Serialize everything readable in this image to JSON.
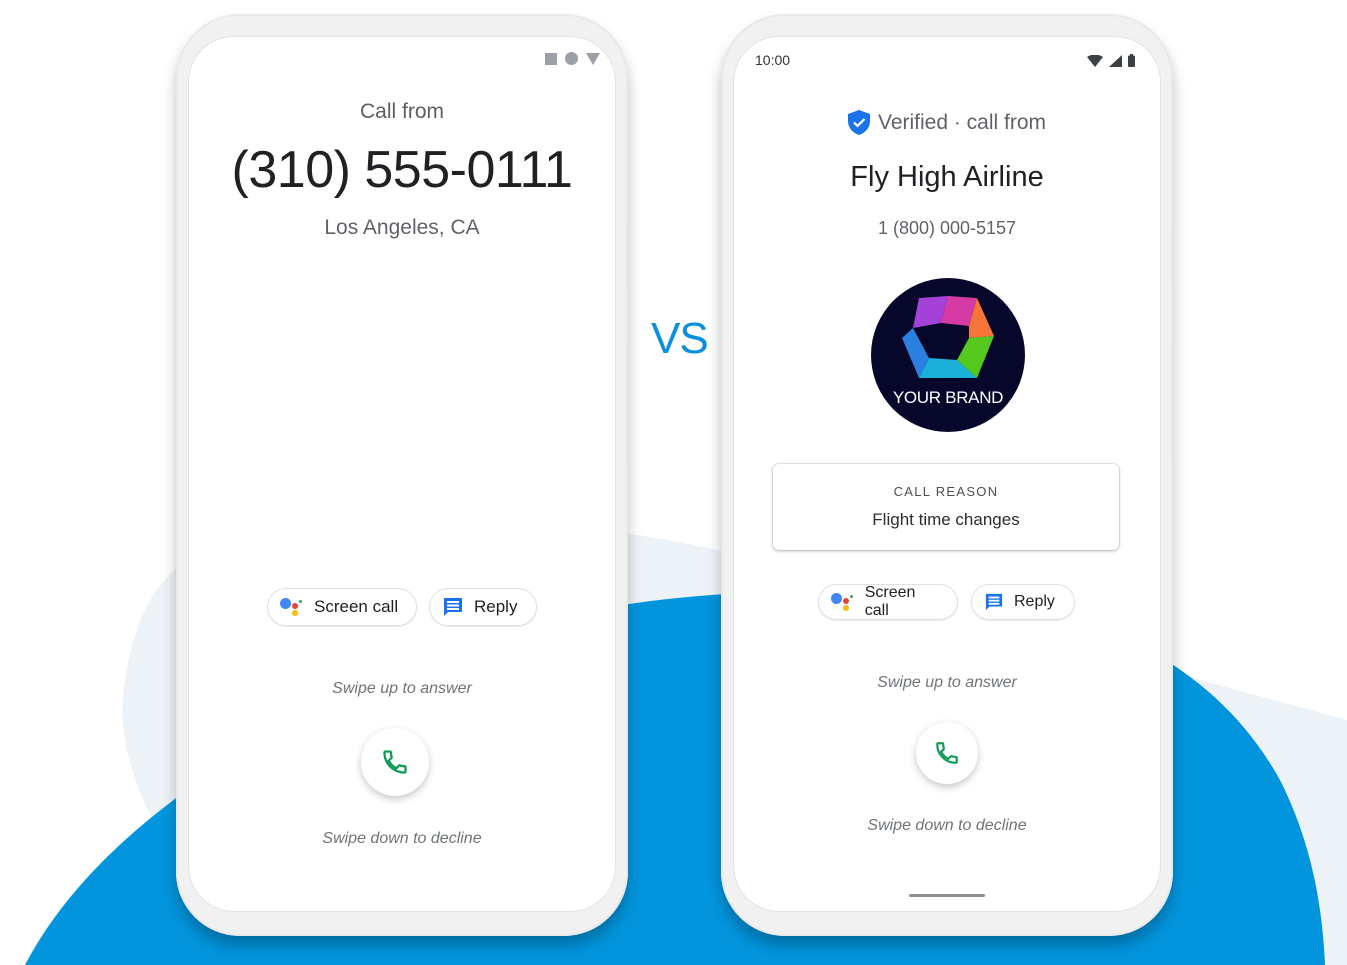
{
  "colors": {
    "accent_blue": "#0295dd",
    "light_blob": "#edf2f7",
    "answer_green": "#0f9d58",
    "verified_blue": "#1a73e8"
  },
  "vs_label": "VS",
  "left_phone": {
    "status_icons": [
      "square-icon",
      "circle-icon",
      "triangle-icon"
    ],
    "call_from_label": "Call from",
    "phone_number": "(310) 555-0111",
    "location": "Los Angeles, CA",
    "actions": {
      "screen_call_label": "Screen call",
      "reply_label": "Reply"
    },
    "swipe_up_text": "Swipe up to answer",
    "swipe_down_text": "Swipe down to decline"
  },
  "right_phone": {
    "status_time": "10:00",
    "status_icons": [
      "wifi-icon",
      "signal-icon",
      "battery-icon"
    ],
    "verified_label": "Verified · call from",
    "business_name": "Fly High Airline",
    "phone_number": "1 (800) 000-5157",
    "brand_logo_text": "YOUR BRAND",
    "call_reason": {
      "label": "CALL REASON",
      "value": "Flight time changes"
    },
    "actions": {
      "screen_call_label": "Screen call",
      "reply_label": "Reply"
    },
    "swipe_up_text": "Swipe up to answer",
    "swipe_down_text": "Swipe down to decline"
  }
}
